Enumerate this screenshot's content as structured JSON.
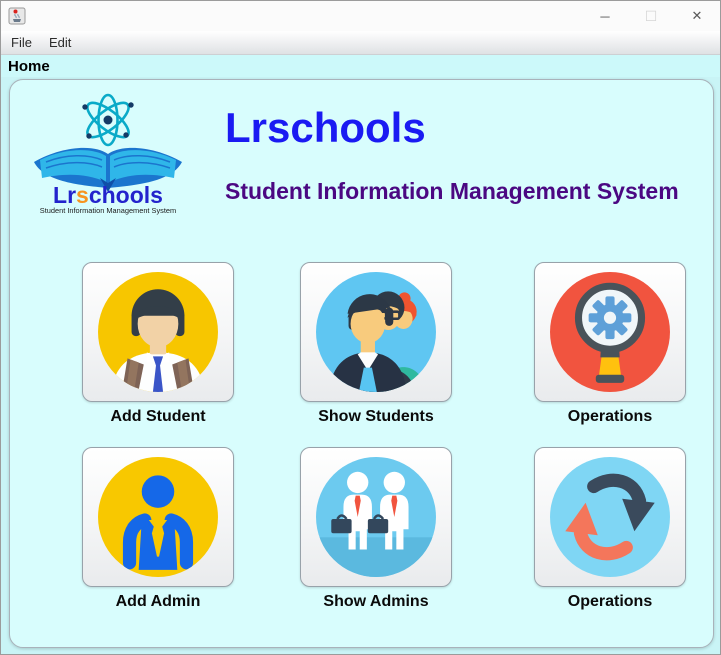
{
  "window": {
    "controls": {
      "minimize": "─",
      "maximize": "☐",
      "close": "✕"
    }
  },
  "menubar": {
    "items": [
      {
        "label": "File"
      },
      {
        "label": "Edit"
      }
    ]
  },
  "home": {
    "label": "Home"
  },
  "header": {
    "title": "Lrschools",
    "subtitle": "Student Information Management System"
  },
  "logo": {
    "brand_prefix": "Lr",
    "brand_accent": "s",
    "brand_suffix": "chools",
    "tagline": "Student Information Management System"
  },
  "tiles": [
    {
      "label": "Add Student",
      "icon": "student-icon"
    },
    {
      "label": "Show Students",
      "icon": "students-group-icon"
    },
    {
      "label": "Operations",
      "icon": "gear-magnifier-icon"
    },
    {
      "label": "Add Admin",
      "icon": "admin-icon"
    },
    {
      "label": "Show Admins",
      "icon": "admins-group-icon"
    },
    {
      "label": "Operations",
      "icon": "sync-arrows-icon"
    }
  ],
  "colors": {
    "window_bg": "#c9f4f6",
    "panel_bg": "#d8fdfd",
    "title_blue": "#1a1af2",
    "subtitle_purple": "#4b0882",
    "brand_blue": "#2323cc",
    "brand_accent_orange": "#f7941e",
    "student_circle_yellow": "#f7c600",
    "students_circle_blue": "#5fc6f2",
    "operations_circle_red": "#f1543f",
    "admin_circle_yellow": "#f8c800",
    "admins_circle_blue": "#6ccaef",
    "sync_circle_blue": "#7fd6f4"
  }
}
